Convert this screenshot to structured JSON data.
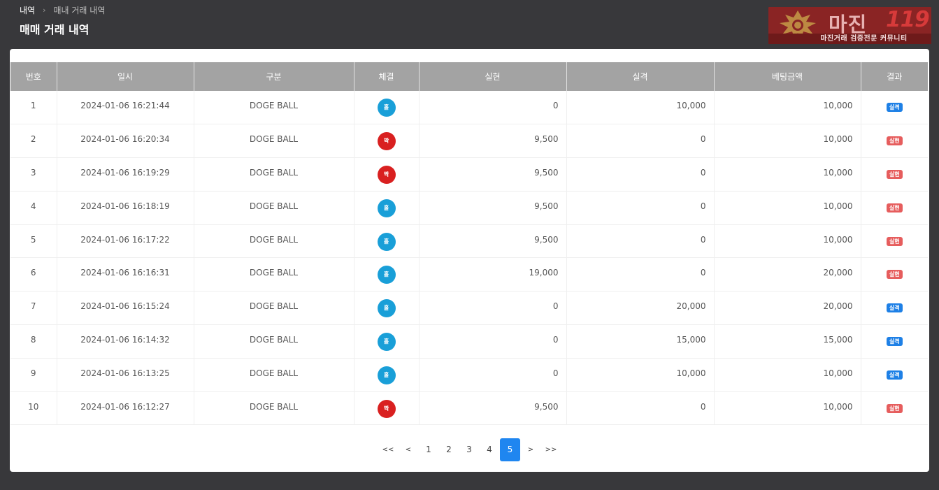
{
  "header": {
    "breadcrumb_root": "내역",
    "breadcrumb_current": "매내 거래 내역",
    "title": "매매 거래 내역"
  },
  "logo": {
    "brand": "마진",
    "brand_num": "119",
    "tagline": "마진거래 검증전문 커뮤니티",
    "colors": {
      "bg": "#8a2424",
      "accent": "#d73a3a"
    }
  },
  "table": {
    "columns": [
      "번호",
      "일시",
      "구분",
      "체결",
      "실현",
      "실격",
      "베팅금액",
      "결과"
    ],
    "rows": [
      {
        "no": "1",
        "datetime": "2024-01-06 16:21:44",
        "type": "DOGE BALL",
        "fill": "홀",
        "fill_kind": "odd",
        "realized": "0",
        "lost": "10,000",
        "bet": "10,000",
        "result": "실격",
        "result_kind": "loss"
      },
      {
        "no": "2",
        "datetime": "2024-01-06 16:20:34",
        "type": "DOGE BALL",
        "fill": "짝",
        "fill_kind": "even",
        "realized": "9,500",
        "lost": "0",
        "bet": "10,000",
        "result": "실현",
        "result_kind": "win"
      },
      {
        "no": "3",
        "datetime": "2024-01-06 16:19:29",
        "type": "DOGE BALL",
        "fill": "짝",
        "fill_kind": "even",
        "realized": "9,500",
        "lost": "0",
        "bet": "10,000",
        "result": "실현",
        "result_kind": "win"
      },
      {
        "no": "4",
        "datetime": "2024-01-06 16:18:19",
        "type": "DOGE BALL",
        "fill": "홀",
        "fill_kind": "odd",
        "realized": "9,500",
        "lost": "0",
        "bet": "10,000",
        "result": "실현",
        "result_kind": "win"
      },
      {
        "no": "5",
        "datetime": "2024-01-06 16:17:22",
        "type": "DOGE BALL",
        "fill": "홀",
        "fill_kind": "odd",
        "realized": "9,500",
        "lost": "0",
        "bet": "10,000",
        "result": "실현",
        "result_kind": "win"
      },
      {
        "no": "6",
        "datetime": "2024-01-06 16:16:31",
        "type": "DOGE BALL",
        "fill": "홀",
        "fill_kind": "odd",
        "realized": "19,000",
        "lost": "0",
        "bet": "20,000",
        "result": "실현",
        "result_kind": "win"
      },
      {
        "no": "7",
        "datetime": "2024-01-06 16:15:24",
        "type": "DOGE BALL",
        "fill": "홀",
        "fill_kind": "odd",
        "realized": "0",
        "lost": "20,000",
        "bet": "20,000",
        "result": "실격",
        "result_kind": "loss"
      },
      {
        "no": "8",
        "datetime": "2024-01-06 16:14:32",
        "type": "DOGE BALL",
        "fill": "홀",
        "fill_kind": "odd",
        "realized": "0",
        "lost": "15,000",
        "bet": "15,000",
        "result": "실격",
        "result_kind": "loss"
      },
      {
        "no": "9",
        "datetime": "2024-01-06 16:13:25",
        "type": "DOGE BALL",
        "fill": "홀",
        "fill_kind": "odd",
        "realized": "0",
        "lost": "10,000",
        "bet": "10,000",
        "result": "실격",
        "result_kind": "loss"
      },
      {
        "no": "10",
        "datetime": "2024-01-06 16:12:27",
        "type": "DOGE BALL",
        "fill": "짝",
        "fill_kind": "even",
        "realized": "9,500",
        "lost": "0",
        "bet": "10,000",
        "result": "실현",
        "result_kind": "win"
      }
    ]
  },
  "pagination": {
    "first": "<<",
    "prev": "<",
    "pages": [
      "1",
      "2",
      "3",
      "4",
      "5"
    ],
    "current": "5",
    "next": ">",
    "last": ">>"
  },
  "colors": {
    "odd_ball": "#199fd8",
    "even_ball": "#d92020",
    "loss_badge": "#1e80e6",
    "win_badge": "#e65d5d",
    "active_page": "#1f86f0",
    "header_row": "#a3a3a3",
    "background": "#38383b"
  }
}
